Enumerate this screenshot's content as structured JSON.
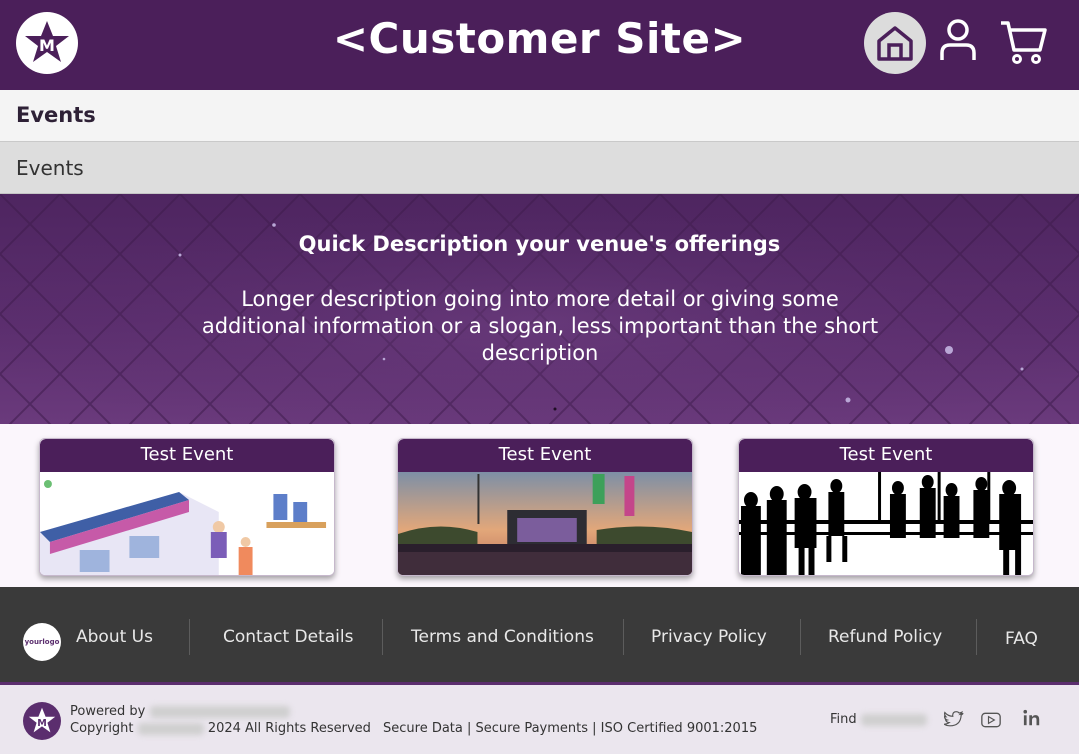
{
  "header": {
    "title": "<Customer Site>",
    "logo_icon": "brand-star-m-logo",
    "home_icon": "home-icon",
    "user_icon": "user-icon",
    "cart_icon": "cart-icon"
  },
  "breadcrumb": {
    "primary": "Events",
    "secondary": "Events"
  },
  "hero": {
    "title": "Quick Description your venue's offerings",
    "description": "Longer description going into more detail or giving some additional information or a slogan, less important than the short description"
  },
  "events": [
    {
      "title": "Test Event"
    },
    {
      "title": "Test Event"
    },
    {
      "title": "Test Event"
    }
  ],
  "footer": {
    "logo_text": "yourlogo",
    "links": [
      "About Us",
      "Contact Details",
      "Terms and Conditions",
      "Privacy Policy",
      "Refund Policy",
      "FAQ"
    ]
  },
  "bottom": {
    "powered_by": "Powered by",
    "copyright_prefix": "Copyright",
    "copyright_suffix": "2024 All Rights Reserved",
    "security": "Secure Data | Secure Payments | ISO Certified 9001:2015",
    "find": "Find"
  },
  "colors": {
    "brand": "#4b1f5a",
    "footer": "#3a3a3a"
  }
}
